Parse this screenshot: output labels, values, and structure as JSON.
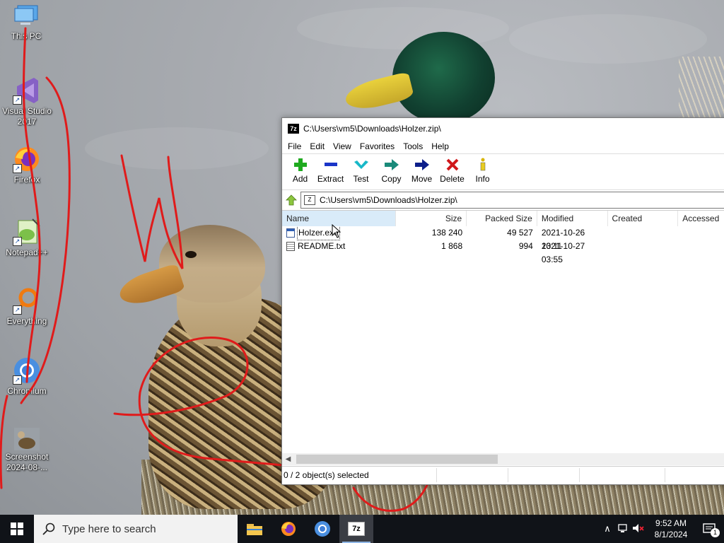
{
  "desktop": {
    "icons": [
      {
        "label": "This PC",
        "name": "this-pc"
      },
      {
        "label": "Visual Studio 2017",
        "name": "visual-studio-2017"
      },
      {
        "label": "Firefox",
        "name": "firefox"
      },
      {
        "label": "Notepad++",
        "name": "notepad-plus-plus"
      },
      {
        "label": "Everything",
        "name": "everything"
      },
      {
        "label": "Chromium",
        "name": "chromium"
      },
      {
        "label": "Screenshot 2024-08-...",
        "name": "screenshot-file"
      }
    ],
    "ghost_labels": {
      "visual": "Visual Studio 2017",
      "firefox": "Firefox",
      "notepad": "Notepad++",
      "everything": "Everything",
      "chromium": "Chromium"
    }
  },
  "window": {
    "title": "C:\\Users\\vm5\\Downloads\\Holzer.zip\\",
    "app_badge": "7z",
    "menu": [
      "File",
      "Edit",
      "View",
      "Favorites",
      "Tools",
      "Help"
    ],
    "toolbar": [
      {
        "label": "Add",
        "icon": "plus-icon",
        "color": "#1faa1f"
      },
      {
        "label": "Extract",
        "icon": "minus-icon",
        "color": "#1a35c8"
      },
      {
        "label": "Test",
        "icon": "check-icon",
        "color": "#18b8c8"
      },
      {
        "label": "Copy",
        "icon": "copy-arrow-icon",
        "color": "#1a8a7a"
      },
      {
        "label": "Move",
        "icon": "move-arrow-icon",
        "color": "#0d1f8a"
      },
      {
        "label": "Delete",
        "icon": "x-icon",
        "color": "#d0181b"
      },
      {
        "label": "Info",
        "icon": "info-icon",
        "color": "#d8b400"
      }
    ],
    "address": "C:\\Users\\vm5\\Downloads\\Holzer.zip\\",
    "columns": [
      "Name",
      "Size",
      "Packed Size",
      "Modified",
      "Created",
      "Accessed"
    ],
    "rows": [
      {
        "name": "Holzer.exe",
        "size": "138 240",
        "packed": "49 527",
        "modified": "2021-10-26 13:11",
        "created": "",
        "accessed": "",
        "icon": "exe-file-icon"
      },
      {
        "name": "README.txt",
        "size": "1 868",
        "packed": "994",
        "modified": "2021-10-27 03:55",
        "created": "",
        "accessed": "",
        "icon": "txt-file-icon"
      }
    ],
    "status": "0 / 2 object(s) selected"
  },
  "taskbar": {
    "search_placeholder": "Type here to search",
    "apps": [
      {
        "name": "file-explorer",
        "icon": "folder-icon"
      },
      {
        "name": "firefox",
        "icon": "firefox-icon"
      },
      {
        "name": "chromium",
        "icon": "chromium-icon"
      },
      {
        "name": "7zip",
        "icon": "7zip-icon",
        "label": "7z",
        "active": true
      }
    ],
    "clock_time": "9:52 AM",
    "clock_date": "8/1/2024",
    "notification_count": "1"
  },
  "colors": {
    "taskbar": "#101318",
    "scribble": "#e01b1b",
    "selected_header": "#d9ebf9"
  }
}
